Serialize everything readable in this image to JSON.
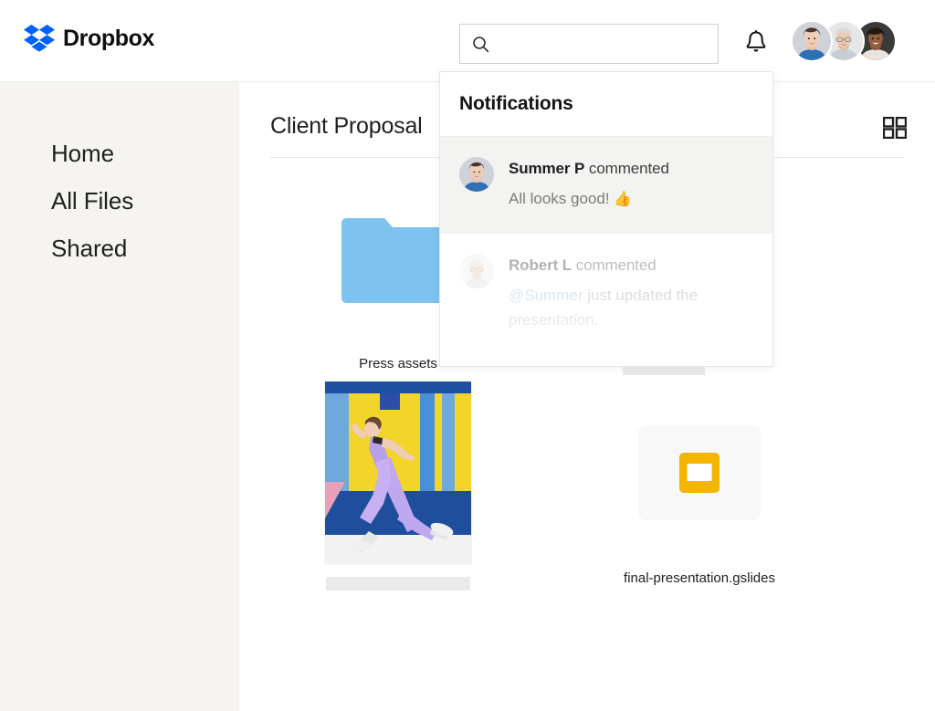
{
  "header": {
    "brand_name": "Dropbox",
    "brand_logo_icon": "dropbox-logo-icon",
    "search": {
      "value": "",
      "placeholder": "",
      "icon": "search-icon"
    },
    "bell_icon": "notification-bell-icon",
    "avatars": [
      {
        "name": "avatar-user-1"
      },
      {
        "name": "avatar-user-2"
      },
      {
        "name": "avatar-user-3"
      }
    ]
  },
  "sidebar": {
    "items": [
      {
        "label": "Home"
      },
      {
        "label": "All Files"
      },
      {
        "label": "Shared"
      }
    ]
  },
  "main": {
    "page_title": "Client Proposal",
    "view_toggle_icon": "grid-view-icon",
    "files": [
      {
        "label": "Press assets",
        "kind": "folder",
        "icon": "folder-icon"
      },
      {
        "label": "",
        "kind": "document",
        "icon": "document-card-icon"
      },
      {
        "label": "",
        "kind": "photo",
        "icon": "photo-thumbnail",
        "label_loading": true
      },
      {
        "label": "final-presentation.gslides",
        "kind": "slides",
        "icon": "google-slides-icon"
      }
    ]
  },
  "notifications": {
    "title": "Notifications",
    "items": [
      {
        "actor": "Summer P",
        "verb": "commented",
        "message_prefix": "",
        "message": "All looks good!",
        "emoji": "👍",
        "avatar": "avatar-summer-p",
        "highlighted": true
      },
      {
        "actor": "Robert L",
        "verb": "commented",
        "mention": "@Summer",
        "message": " just updated the presentation.",
        "emoji": "",
        "avatar": "avatar-robert-l",
        "highlighted": false
      }
    ]
  },
  "colors": {
    "brand_blue": "#0061fe",
    "sidebar_bg": "#f5f4f0",
    "folder_blue": "#7ec2f0",
    "slides_yellow": "#f4b400",
    "mention_blue": "#6d9ede",
    "row_highlight": "#f3f3f1"
  }
}
